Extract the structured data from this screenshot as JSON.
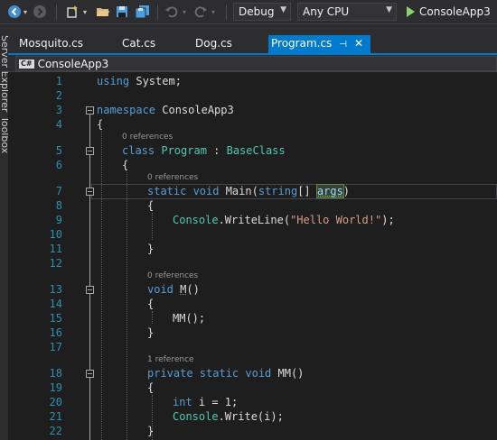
{
  "toolbar": {
    "icons": [
      "back-icon",
      "forward-icon",
      "new-project-icon",
      "open-folder-icon",
      "save-icon",
      "save-all-icon",
      "undo-icon",
      "redo-icon"
    ],
    "configuration": "Debug",
    "platform": "Any CPU",
    "start_project": "ConsoleApp3"
  },
  "side_tabs": [
    "Server Explorer",
    "Toolbox"
  ],
  "tabs": [
    {
      "label": "Mosquito.cs",
      "active": false
    },
    {
      "label": "Cat.cs",
      "active": false
    },
    {
      "label": "Dog.cs",
      "active": false
    },
    {
      "label": "Program.cs",
      "active": true
    }
  ],
  "navbar": {
    "project": "ConsoleApp3",
    "badge": "C#"
  },
  "editor": {
    "line_numbers": [
      "1",
      "2",
      "3",
      "4",
      "5",
      "6",
      "7",
      "8",
      "9",
      "10",
      "11",
      "12",
      "13",
      "14",
      "15",
      "16",
      "17",
      "18",
      "19",
      "20",
      "21",
      "22"
    ],
    "code": {
      "using_kw": "using",
      "using_rest": " System;",
      "namespace_kw": "namespace",
      "namespace_rest": " ConsoleApp3",
      "brace_open": "{",
      "brace_close": "}",
      "class_kw": "class",
      "class_name": " Program",
      "colon": " : ",
      "base_class": "BaseClass",
      "static_kw": "static",
      "void_kw": " void",
      "main_name": " Main(",
      "string_kw": "string",
      "array_part": "[] ",
      "args": "args",
      "paren_close": ")",
      "console": "Console",
      "writeline": ".WriteLine(",
      "hello_str": "\"Hello World!\"",
      "paren_semi": ");",
      "void_kw2": "void",
      "m_name": "M",
      "m_parens": "()",
      "mm_call": "MM();",
      "private_kw": "private",
      "static_kw2": " static",
      "void_kw3": " void",
      "mm_decl": " MM()",
      "int_kw": "int",
      "int_rest": " i = 1;",
      "console2": "Console",
      "write_rest": ".Write(i);"
    },
    "codelens": {
      "ref0_a": "0 references",
      "ref0_b": "0 references",
      "ref0_c": "0 references",
      "ref1": "1 reference"
    }
  }
}
